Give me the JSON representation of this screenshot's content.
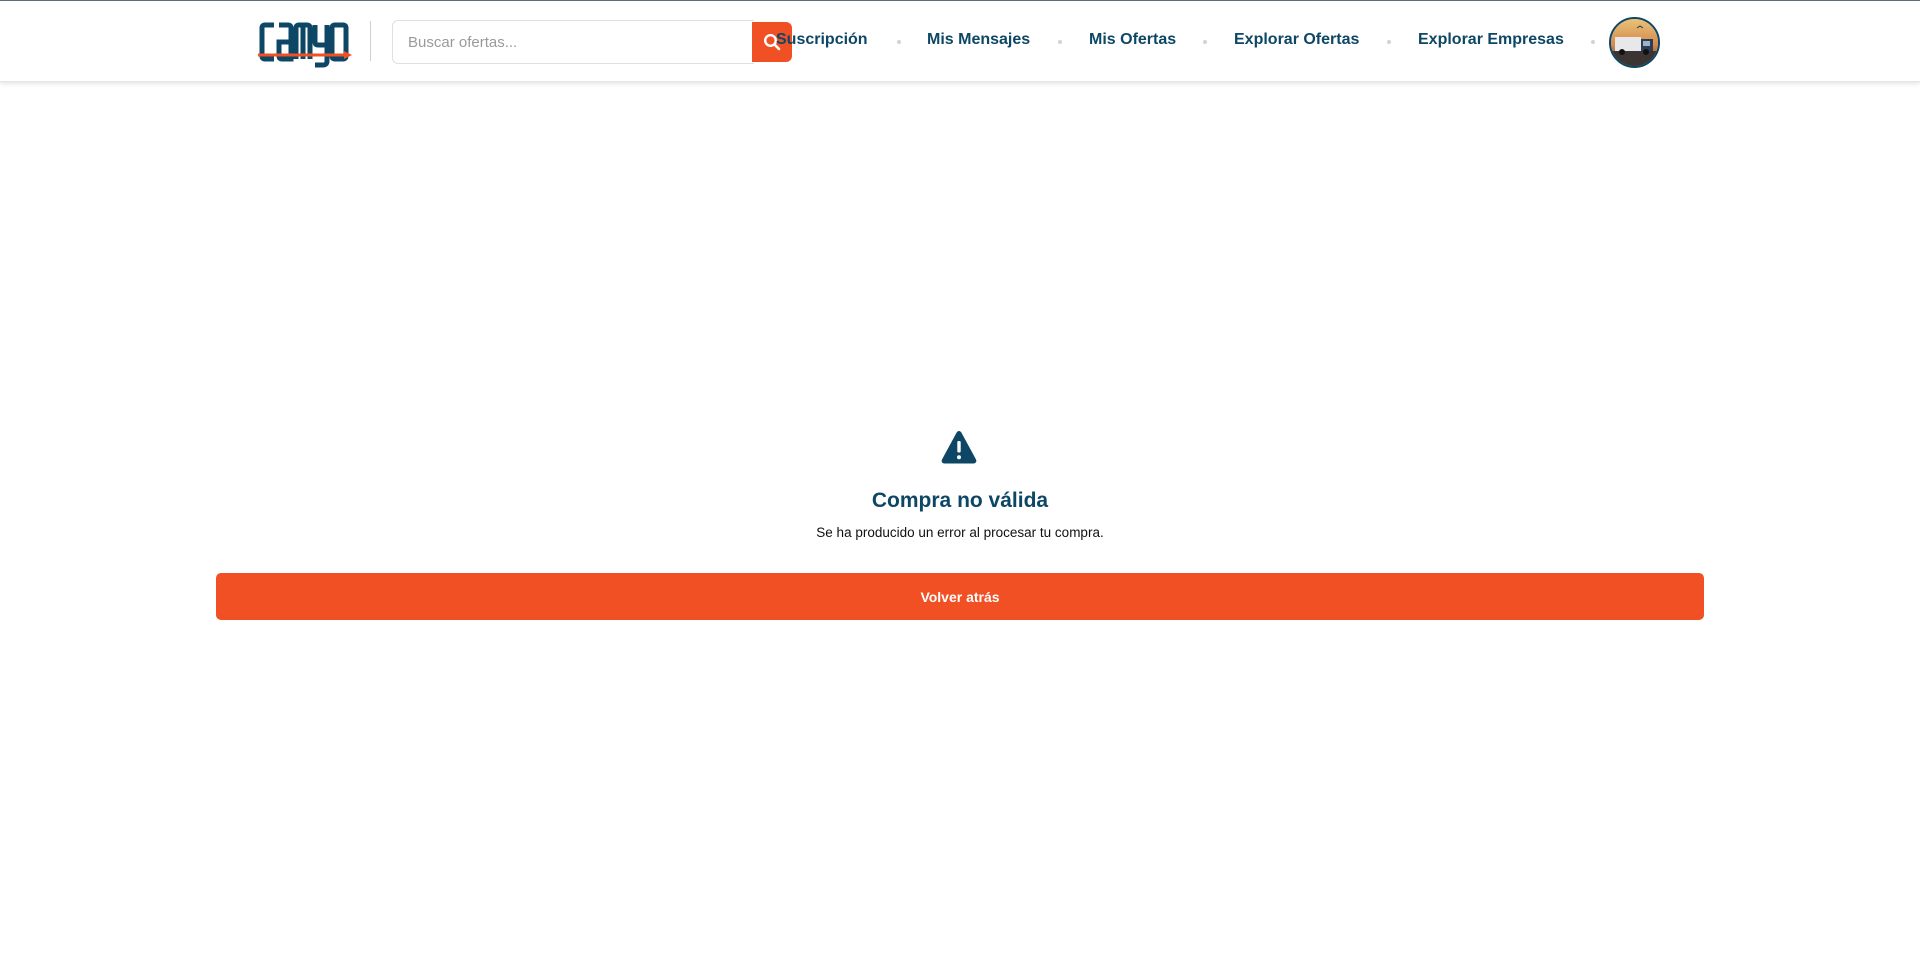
{
  "header": {
    "logo_text": "camyo",
    "search": {
      "placeholder": "Buscar ofertas...",
      "value": ""
    },
    "nav": [
      {
        "label": "Suscripción"
      },
      {
        "label": "Mis Mensajes"
      },
      {
        "label": "Mis Ofertas"
      },
      {
        "label": "Explorar Ofertas"
      },
      {
        "label": "Explorar Empresas"
      }
    ],
    "avatar_icon": "user-avatar"
  },
  "main": {
    "icon": "warning-icon",
    "title": "Compra no válida",
    "message": "Se ha producido un error al procesar tu compra.",
    "back_button_label": "Volver atrás"
  },
  "colors": {
    "brand_dark": "#0d4765",
    "accent": "#f05023"
  }
}
